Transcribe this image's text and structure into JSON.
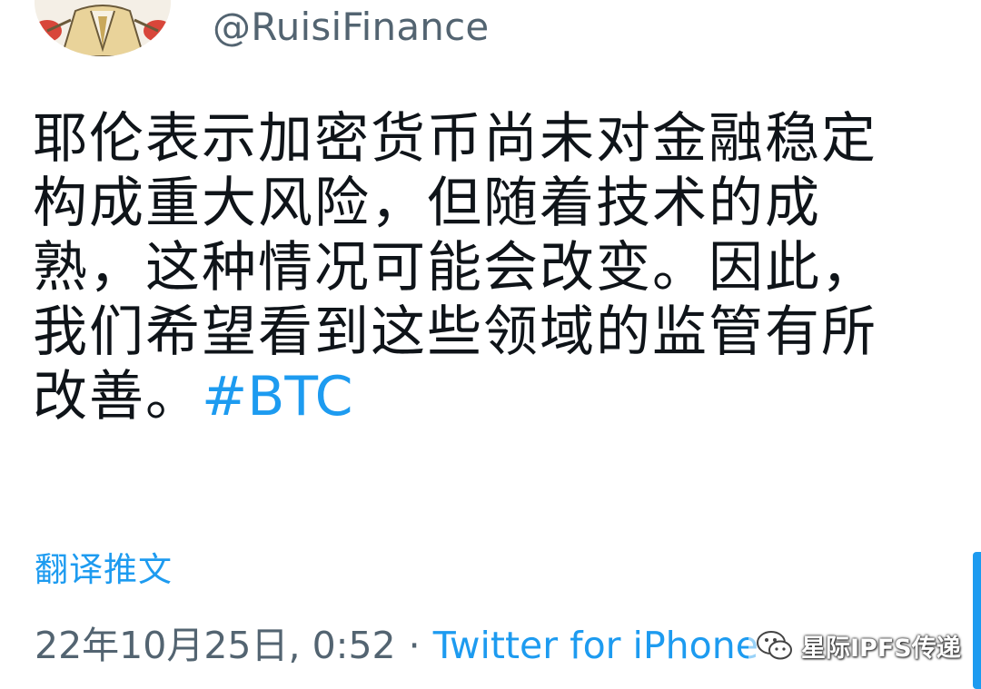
{
  "author": {
    "handle": "@RuisiFinance"
  },
  "tweet": {
    "lines": [
      "耶伦表示加密货币尚未对金融稳定",
      "构成重大风险，但随着技术的成",
      "熟，这种情况可能会改变。因此，",
      "我们希望看到这些领域的监管有所"
    ],
    "last_line_text": "改善。",
    "hashtag": "#BTC"
  },
  "translate_label": "翻译推文",
  "meta": {
    "timestamp": "22年10月25日, 0:52",
    "separator": "·",
    "source": "Twitter for iPhone"
  },
  "watermark": {
    "text": "星际IPFS传递",
    "icon": "wechat-icon"
  },
  "colors": {
    "accent": "#1d9bf0",
    "text": "#0f1419",
    "secondary": "#536471"
  }
}
